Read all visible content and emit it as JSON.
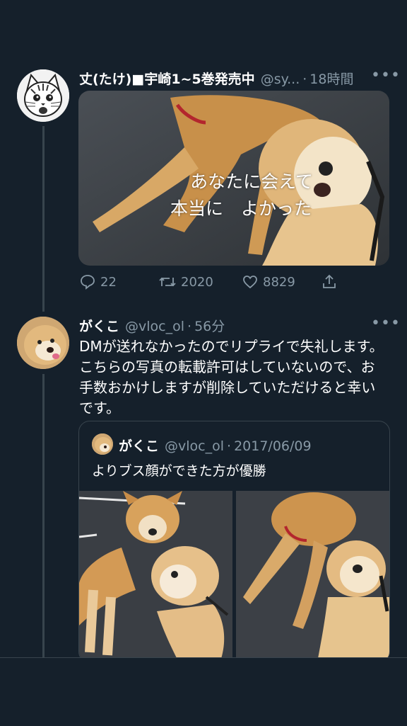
{
  "tweet1": {
    "name": "丈(たけ)■宇崎1~5巻発売中",
    "handle": "@sy...",
    "time": "18時間",
    "image_caption_line1": "あなたに会えて",
    "image_caption_line2": "本当に　よかった",
    "replies": "22",
    "retweets": "2020",
    "likes": "8829"
  },
  "tweet2": {
    "name": "がくこ",
    "handle": "@vloc_ol",
    "time": "56分",
    "text_line1": "DMが送れなかったのでリプライで失礼します。",
    "text_line2": "こちらの写真の転載許可はしていないので、お",
    "text_line3": "手数おかけしますが削除していただけると幸い",
    "text_line4": "です。"
  },
  "quote": {
    "name": "がくこ",
    "handle": "@vloc_ol",
    "date": "2017/06/09",
    "text": "よりブス顔ができた方が優勝"
  },
  "separator": "·",
  "more_glyph": "•••",
  "colors": {
    "background": "#15202b",
    "secondary_text": "#8899a6",
    "border": "#38444d"
  }
}
